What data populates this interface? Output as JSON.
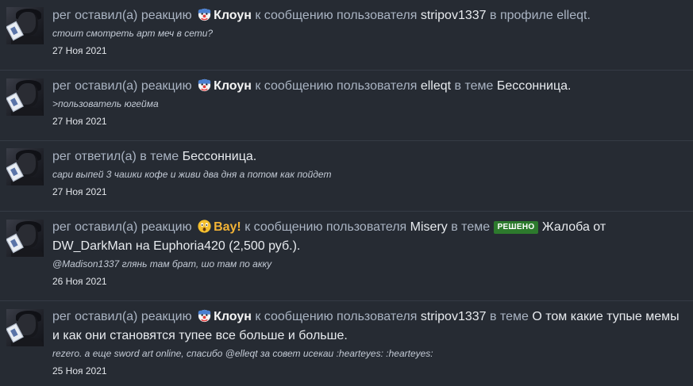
{
  "items": [
    {
      "user": "рег",
      "action": "оставил(а) реакцию",
      "reaction": "Клоун",
      "reaction_icon": "clown-icon",
      "connector": "к сообщению пользователя",
      "target_user": "stripov1337",
      "location_prefix": "в профиле",
      "location": "elleqt",
      "location_suffix": ".",
      "snippet": "стоит смотреть арт меч в сети?",
      "date": "27 Ноя 2021"
    },
    {
      "user": "рег",
      "action": "оставил(а) реакцию",
      "reaction": "Клоун",
      "reaction_icon": "clown-icon",
      "connector": "к сообщению пользователя",
      "target_user": "elleqt",
      "location_prefix": "в теме",
      "location": "Бессонница",
      "location_suffix": ".",
      "snippet": ">пользователь югейма",
      "date": "27 Ноя 2021"
    },
    {
      "user": "рег",
      "action": "ответил(а) в теме",
      "location": "Бессонница",
      "location_suffix": ".",
      "snippet": "сари выпей 3 чашки кофе и живи два дня а потом как пойдет",
      "date": "27 Ноя 2021"
    },
    {
      "user": "рег",
      "action": "оставил(а) реакцию",
      "reaction": "Вау!",
      "reaction_icon": "wow-icon",
      "connector": "к сообщению пользователя",
      "target_user": "Misery",
      "location_prefix": "в теме",
      "badge": "РЕШЕНО",
      "location": "Жалоба от DW_DarkMan на Euphoria420 (2,500 руб.)",
      "location_suffix": ".",
      "snippet": "@Madison1337 глянь там брат, шо там по акку",
      "date": "26 Ноя 2021"
    },
    {
      "user": "рег",
      "action": "оставил(а) реакцию",
      "reaction": "Клоун",
      "reaction_icon": "clown-icon",
      "connector": "к сообщению пользователя",
      "target_user": "stripov1337",
      "location_prefix": "в теме",
      "location": "О том какие тупые мемы и как они становятся тупее все больше и больше.",
      "location_suffix": ".",
      "snippet": "rezero. а еще sword art online, спасибо @elleqt за совет исекаи :hearteyes: :hearteyes:",
      "date": "25 Ноя 2021"
    }
  ],
  "colors": {
    "background": "#262b33",
    "muted_text": "#aab4c3",
    "badge_green": "#2d7a2d",
    "wow_reaction": "#f2b336"
  }
}
